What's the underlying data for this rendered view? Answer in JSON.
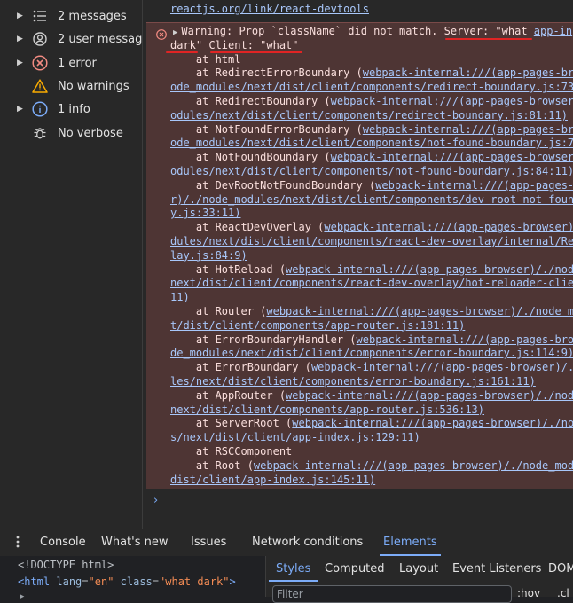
{
  "sidebar": {
    "items": [
      {
        "label": "2 messages",
        "icon": "list-icon",
        "expandable": true
      },
      {
        "label": "2 user messag...",
        "icon": "user-circle-icon",
        "expandable": true
      },
      {
        "label": "1 error",
        "icon": "error-x-icon",
        "expandable": true
      },
      {
        "label": "No warnings",
        "icon": "warning-triangle-icon",
        "expandable": false
      },
      {
        "label": "1 info",
        "icon": "info-icon",
        "expandable": true
      },
      {
        "label": "No verbose",
        "icon": "bug-icon",
        "expandable": false
      }
    ]
  },
  "console": {
    "top_link": "reactjs.org/link/react-devtools",
    "error_lines": [
      {
        "type": "warning",
        "text": "Warning: Prop `className` did not match. Server: \"what ",
        "link": "app-in"
      },
      {
        "type": "plain",
        "text": "dark\" Client: \"what\""
      },
      {
        "type": "frame",
        "text": "    at html"
      },
      {
        "type": "frame",
        "text": "    at RedirectErrorBoundary (",
        "link": "webpack-internal:///(app-pages-br"
      },
      {
        "type": "linkcont",
        "link": "ode_modules/next/dist/client/components/redirect-boundary.js:73"
      },
      {
        "type": "frame",
        "text": "    at RedirectBoundary (",
        "link": "webpack-internal:///(app-pages-browser"
      },
      {
        "type": "linkcont",
        "link": "odules/next/dist/client/components/redirect-boundary.js:81:11)"
      },
      {
        "type": "frame",
        "text": "    at NotFoundErrorBoundary (",
        "link": "webpack-internal:///(app-pages-br"
      },
      {
        "type": "linkcont",
        "link": "ode_modules/next/dist/client/components/not-found-boundary.js:7"
      },
      {
        "type": "frame",
        "text": "    at NotFoundBoundary (",
        "link": "webpack-internal:///(app-pages-browser"
      },
      {
        "type": "linkcont",
        "link": "odules/next/dist/client/components/not-found-boundary.js:84:11)"
      },
      {
        "type": "frame",
        "text": "    at DevRootNotFoundBoundary (",
        "link": "webpack-internal:///(app-pages-"
      },
      {
        "type": "linkcont",
        "link": "r)/./node_modules/next/dist/client/components/dev-root-not-foun"
      },
      {
        "type": "linkcont",
        "link": "y.js:33:11)"
      },
      {
        "type": "frame",
        "text": "    at ReactDevOverlay (",
        "link": "webpack-internal:///(app-pages-browser)"
      },
      {
        "type": "linkcont",
        "link": "dules/next/dist/client/components/react-dev-overlay/internal/Re"
      },
      {
        "type": "linkcont",
        "link": "lay.js:84:9)"
      },
      {
        "type": "frame",
        "text": "    at HotReload (",
        "link": "webpack-internal:///(app-pages-browser)/./node"
      },
      {
        "type": "linkcont",
        "link": "next/dist/client/components/react-dev-overlay/hot-reloader-clie"
      },
      {
        "type": "linkcont",
        "link": "11)"
      },
      {
        "type": "frame",
        "text": "    at Router (",
        "link": "webpack-internal:///(app-pages-browser)/./node_m"
      },
      {
        "type": "linkcont",
        "link": "t/dist/client/components/app-router.js:181:11)"
      },
      {
        "type": "frame",
        "text": "    at ErrorBoundaryHandler (",
        "link": "webpack-internal:///(app-pages-bro"
      },
      {
        "type": "linkcont",
        "link": "de_modules/next/dist/client/components/error-boundary.js:114:9)"
      },
      {
        "type": "frame",
        "text": "    at ErrorBoundary (",
        "link": "webpack-internal:///(app-pages-browser)/./"
      },
      {
        "type": "linkcont",
        "link": "les/next/dist/client/components/error-boundary.js:161:11)"
      },
      {
        "type": "frame",
        "text": "    at AppRouter (",
        "link": "webpack-internal:///(app-pages-browser)/./nod"
      },
      {
        "type": "linkcont",
        "link": "next/dist/client/components/app-router.js:536:13)"
      },
      {
        "type": "frame",
        "text": "    at ServerRoot (",
        "link": "webpack-internal:///(app-pages-browser)/./no"
      },
      {
        "type": "linkcont",
        "link": "s/next/dist/client/app-index.js:129:11)"
      },
      {
        "type": "frame",
        "text": "    at RSCComponent"
      },
      {
        "type": "frame",
        "text": "    at Root (",
        "link": "webpack-internal:///(app-pages-browser)/./node_mod"
      },
      {
        "type": "linkcont",
        "link": "dist/client/app-index.js:145:11)"
      }
    ],
    "prompt_glyph": "›"
  },
  "drawer": {
    "tabs": [
      {
        "label": "Console",
        "active": false
      },
      {
        "label": "What's new",
        "active": false
      },
      {
        "label": "Issues",
        "active": false
      },
      {
        "label": "Network conditions",
        "active": false
      },
      {
        "label": "Elements",
        "active": true
      }
    ]
  },
  "elements": {
    "doctype": "<!DOCTYPE html>",
    "html_tag": "html",
    "attr1_name": "lang",
    "attr1_value": "\"en\"",
    "attr2_name": "class",
    "attr2_value": "\"what dark\""
  },
  "styles": {
    "tabs": [
      {
        "label": "Styles",
        "active": true
      },
      {
        "label": "Computed",
        "active": false
      },
      {
        "label": "Layout",
        "active": false
      },
      {
        "label": "Event Listeners",
        "active": false
      },
      {
        "label": "DOM",
        "active": false
      }
    ],
    "filter_placeholder": "Filter",
    "hov_label": ":hov",
    "cls_label": ".cl"
  },
  "colors": {
    "error_bg": "#4e3534",
    "link": "#a8c7fa",
    "accent": "#7cacf8",
    "underline_red": "#e02424"
  }
}
